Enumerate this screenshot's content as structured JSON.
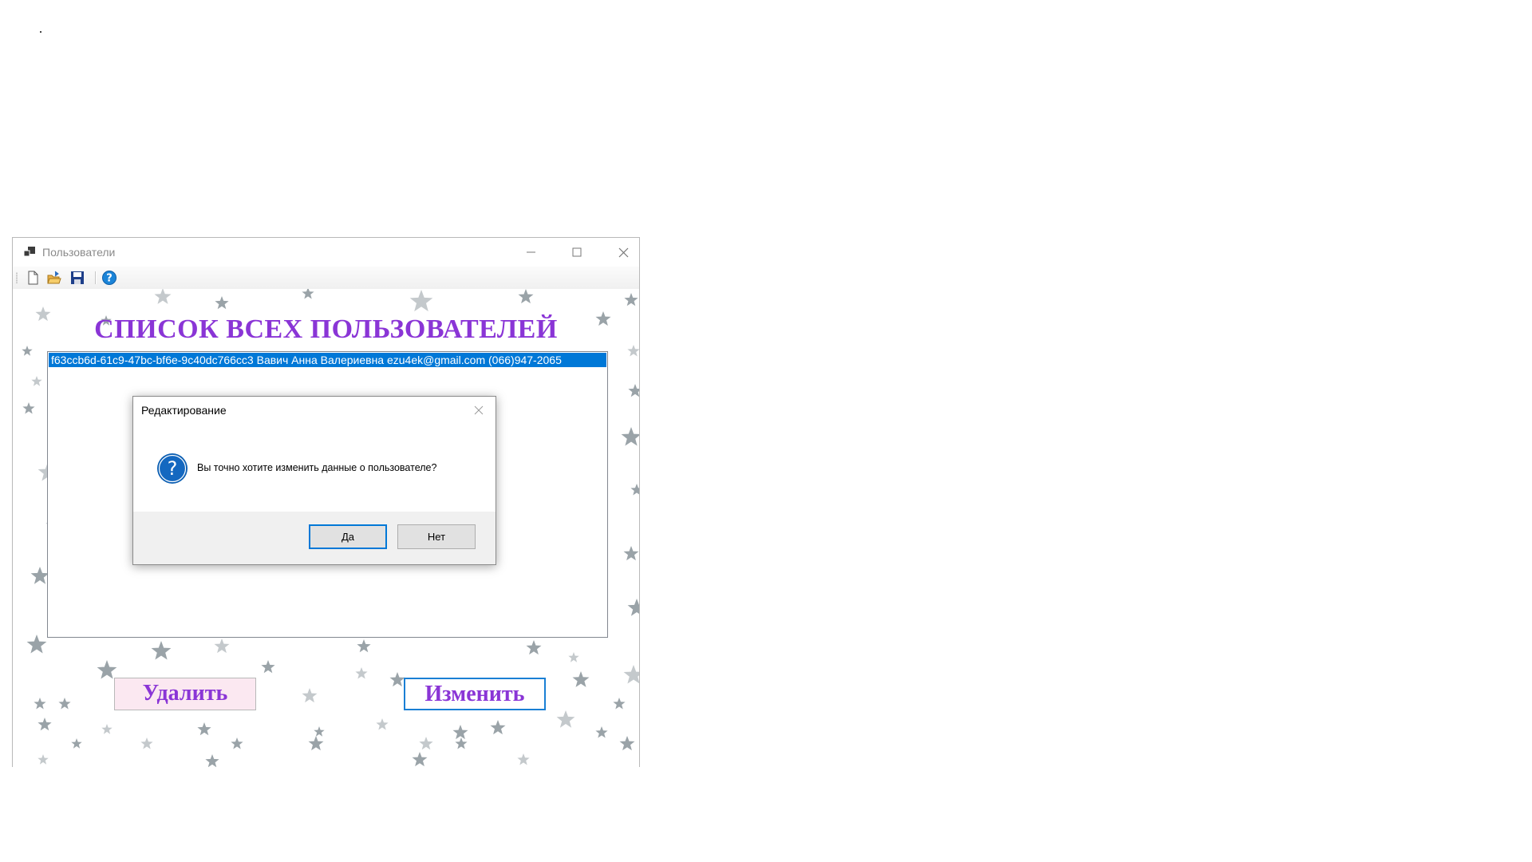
{
  "window": {
    "title": "Пользователи",
    "caption_buttons": [
      "minimize-icon",
      "maximize-icon",
      "close-icon"
    ]
  },
  "toolbar": {
    "buttons": [
      "new-document-icon",
      "open-folder-icon",
      "save-icon",
      "help-icon"
    ]
  },
  "main": {
    "heading": "СПИСОК ВСЕХ ПОЛЬЗОВАТЕЛЕЙ",
    "list_items": [
      "f63ccb6d-61c9-47bc-bf6e-9c40dc766cc3 Вавич Анна Валериевна ezu4ek@gmail.com (066)947-2065"
    ],
    "delete_label": "Удалить",
    "edit_label": "Изменить"
  },
  "dialog": {
    "title": "Редактирование",
    "icon": "question-icon",
    "message": "Вы точно хотите изменить данные о пользователе?",
    "yes_label": "Да",
    "no_label": "Нет"
  },
  "colors": {
    "heading": "#8a35d6",
    "selection": "#0078d7",
    "edit_border": "#1a7fd4",
    "delete_bg": "#fbe8f1",
    "stars": "#9aa3a8"
  }
}
